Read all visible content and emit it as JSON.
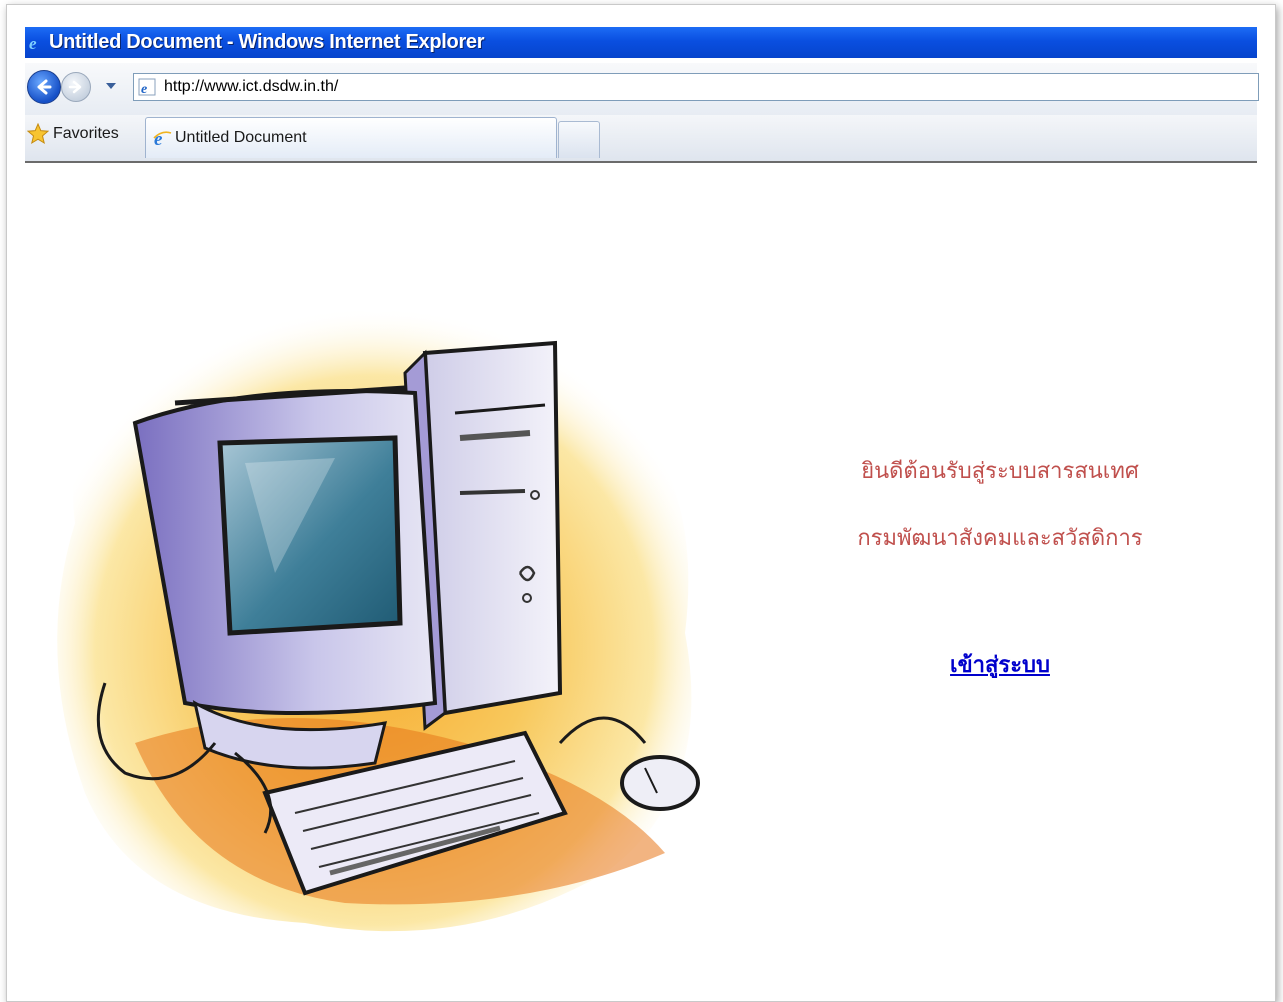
{
  "window": {
    "title": "Untitled Document - Windows Internet Explorer"
  },
  "address_bar": {
    "url": "http://www.ict.dsdw.in.th/"
  },
  "favorites_bar": {
    "favorites_label": "Favorites"
  },
  "tabs": [
    {
      "label": "Untitled Document",
      "active": true
    }
  ],
  "page": {
    "welcome_line_1": "ยินดีต้อนรับสู่ระบบสารสนเทศ",
    "welcome_line_2": "กรมพัฒนาสังคมและสวัสดิการ",
    "login_link": "เข้าสู่ระบบ",
    "illustration": "computer-illustration",
    "colors": {
      "welcome_text": "#c0504d",
      "link": "#0000cc",
      "titlebar": "#0a4fe0"
    }
  },
  "icons": {
    "title": "ie-logo-icon",
    "back": "back-arrow-icon",
    "forward": "forward-arrow-icon",
    "dropdown": "chevron-down-icon",
    "url": "ie-page-icon",
    "favorites": "star-icon",
    "tab": "ie-logo-icon"
  }
}
